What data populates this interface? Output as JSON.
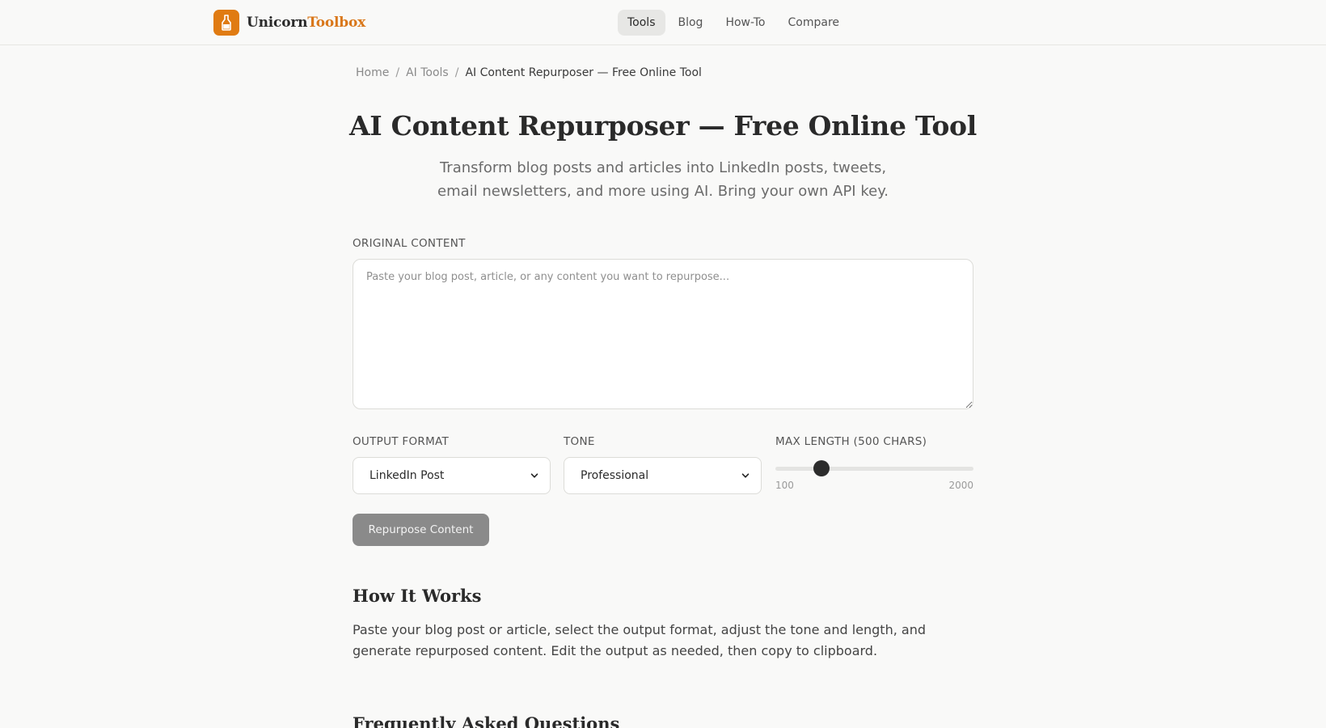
{
  "header": {
    "logo": {
      "brand_part1": "Unicorn",
      "brand_part2": "Toolbox",
      "icon": "bottle-icon",
      "accent_color": "#e07b12"
    },
    "nav": [
      {
        "label": "Tools",
        "active": true
      },
      {
        "label": "Blog",
        "active": false
      },
      {
        "label": "How-To",
        "active": false
      },
      {
        "label": "Compare",
        "active": false
      }
    ]
  },
  "breadcrumb": {
    "items": [
      "Home",
      "AI Tools"
    ],
    "separator": "/",
    "current": "AI Content Repurposer — Free Online Tool"
  },
  "page": {
    "title": "AI Content Repurposer — Free Online Tool",
    "subtitle": "Transform blog posts and articles into LinkedIn posts, tweets, email newsletters, and more using AI. Bring your own API key."
  },
  "form": {
    "original_content": {
      "label": "ORIGINAL CONTENT",
      "placeholder": "Paste your blog post, article, or any content you want to repurpose...",
      "value": ""
    },
    "output_format": {
      "label": "OUTPUT FORMAT",
      "value": "LinkedIn Post"
    },
    "tone": {
      "label": "TONE",
      "value": "Professional"
    },
    "max_length": {
      "label": "MAX LENGTH (500 CHARS)",
      "min": 100,
      "max": 2000,
      "value": 500,
      "min_label": "100",
      "max_label": "2000"
    },
    "submit_label": "Repurpose Content"
  },
  "how_it_works": {
    "heading": "How It Works",
    "text": "Paste your blog post or article, select the output format, adjust the tone and length, and generate repurposed content. Edit the output as needed, then copy to clipboard."
  },
  "faq": {
    "heading": "Frequently Asked Questions"
  }
}
